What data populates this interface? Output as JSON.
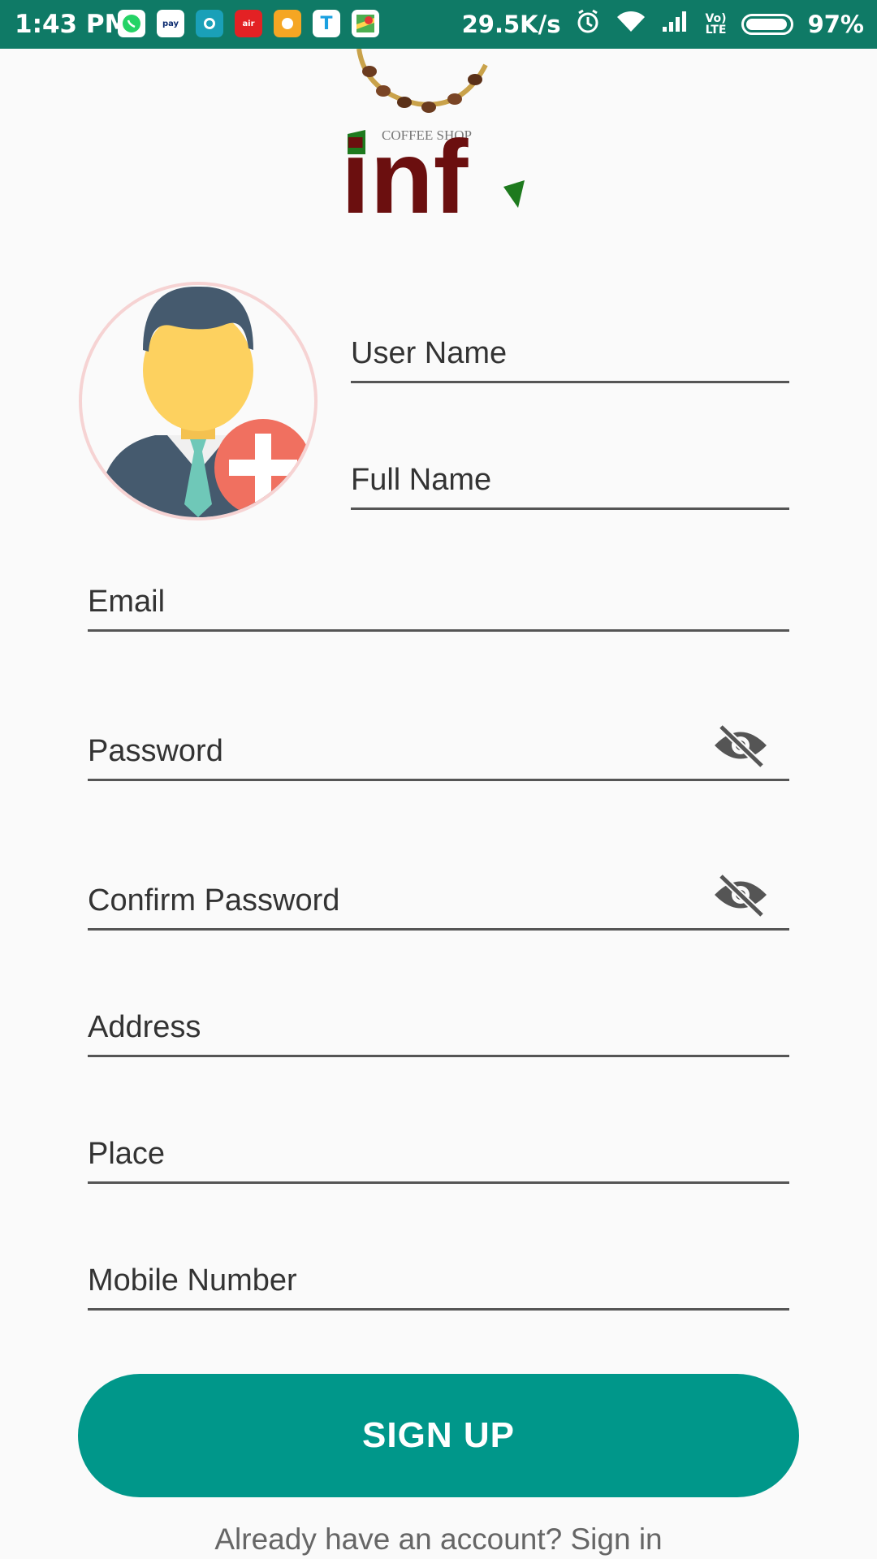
{
  "status_bar": {
    "time": "1:43 PM",
    "network_speed": "29.5K/s",
    "battery_percent": "97%",
    "battery_level": 0.97,
    "app_icons": [
      "whatsapp-icon",
      "paytm-icon",
      "app-icon",
      "airtel-icon",
      "chat-icon",
      "t-icon",
      "maps-icon"
    ],
    "system_icons": [
      "alarm-icon",
      "wifi-icon",
      "signal-icon",
      "volte-icon",
      "battery-icon"
    ]
  },
  "logo": {
    "brand_text": "inf",
    "tagline": "COFFEE SHOP"
  },
  "form": {
    "user_name": {
      "placeholder": "User Name"
    },
    "full_name": {
      "placeholder": "Full Name"
    },
    "email": {
      "placeholder": "Email"
    },
    "password": {
      "placeholder": "Password"
    },
    "confirm_password": {
      "placeholder": "Confirm Password"
    },
    "address": {
      "placeholder": "Address"
    },
    "place": {
      "placeholder": "Place"
    },
    "mobile": {
      "placeholder": "Mobile Number"
    }
  },
  "buttons": {
    "signup_label": "SIGN UP"
  },
  "footer": {
    "signin_text": "Already have an account? Sign in"
  },
  "colors": {
    "status_bar": "#0f7a66",
    "primary": "#00978a",
    "logo_red": "#6b0f0f",
    "logo_green": "#1e7a1e",
    "avatar_plus": "#f07060"
  }
}
